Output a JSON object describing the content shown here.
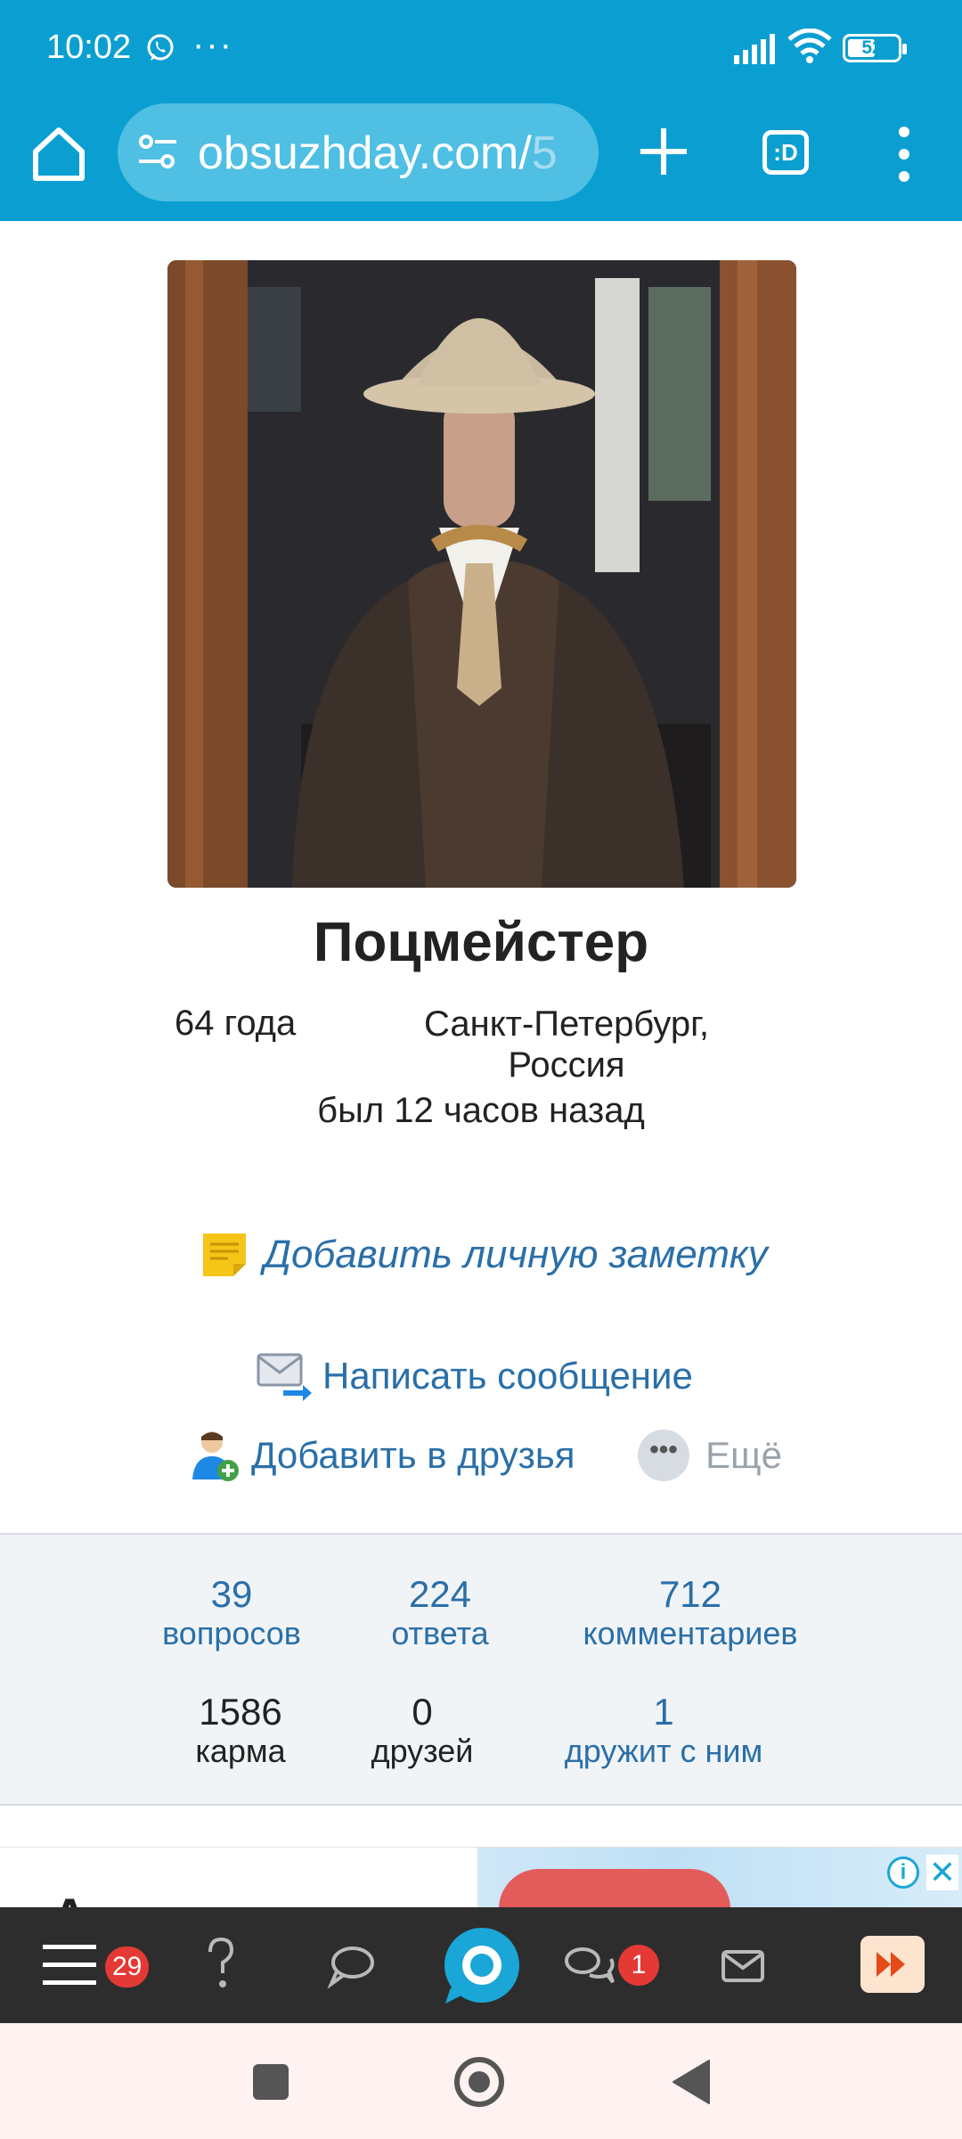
{
  "status_bar": {
    "time": "10:02",
    "dots": "···",
    "battery_level": "52",
    "icons": [
      "whatsapp-icon",
      "signal-icon",
      "wifi-icon",
      "battery-icon"
    ]
  },
  "browser": {
    "url_main": "obsuzhday.com/",
    "url_dim": "5",
    "tabs_label": ":D"
  },
  "profile": {
    "name": "Поцмейстер",
    "age": "64 года",
    "city": "Санкт-Петербург, Россия",
    "last_seen": "был 12 часов назад",
    "actions": {
      "note": "Добавить личную заметку",
      "message": "Написать сообщение",
      "add_friend": "Добавить в друзья",
      "more": "Ещё"
    }
  },
  "stats": {
    "questions": {
      "value": "39",
      "label": "вопросов"
    },
    "answers": {
      "value": "224",
      "label": "ответа"
    },
    "comments": {
      "value": "712",
      "label": "комментариев"
    },
    "karma": {
      "value": "1586",
      "label": "карма"
    },
    "friends": {
      "value": "0",
      "label": "друзей"
    },
    "friended_by": {
      "value": "1",
      "label": "дружит с ним"
    }
  },
  "ad": {
    "text": "А"
  },
  "site_nav": {
    "menu_badge": "29",
    "chats_badge": "1"
  },
  "colors": {
    "chrome": "#0b9fd1",
    "link": "#2a6fa8",
    "badge": "#e53935",
    "nav_bg": "#2d2d2d"
  }
}
